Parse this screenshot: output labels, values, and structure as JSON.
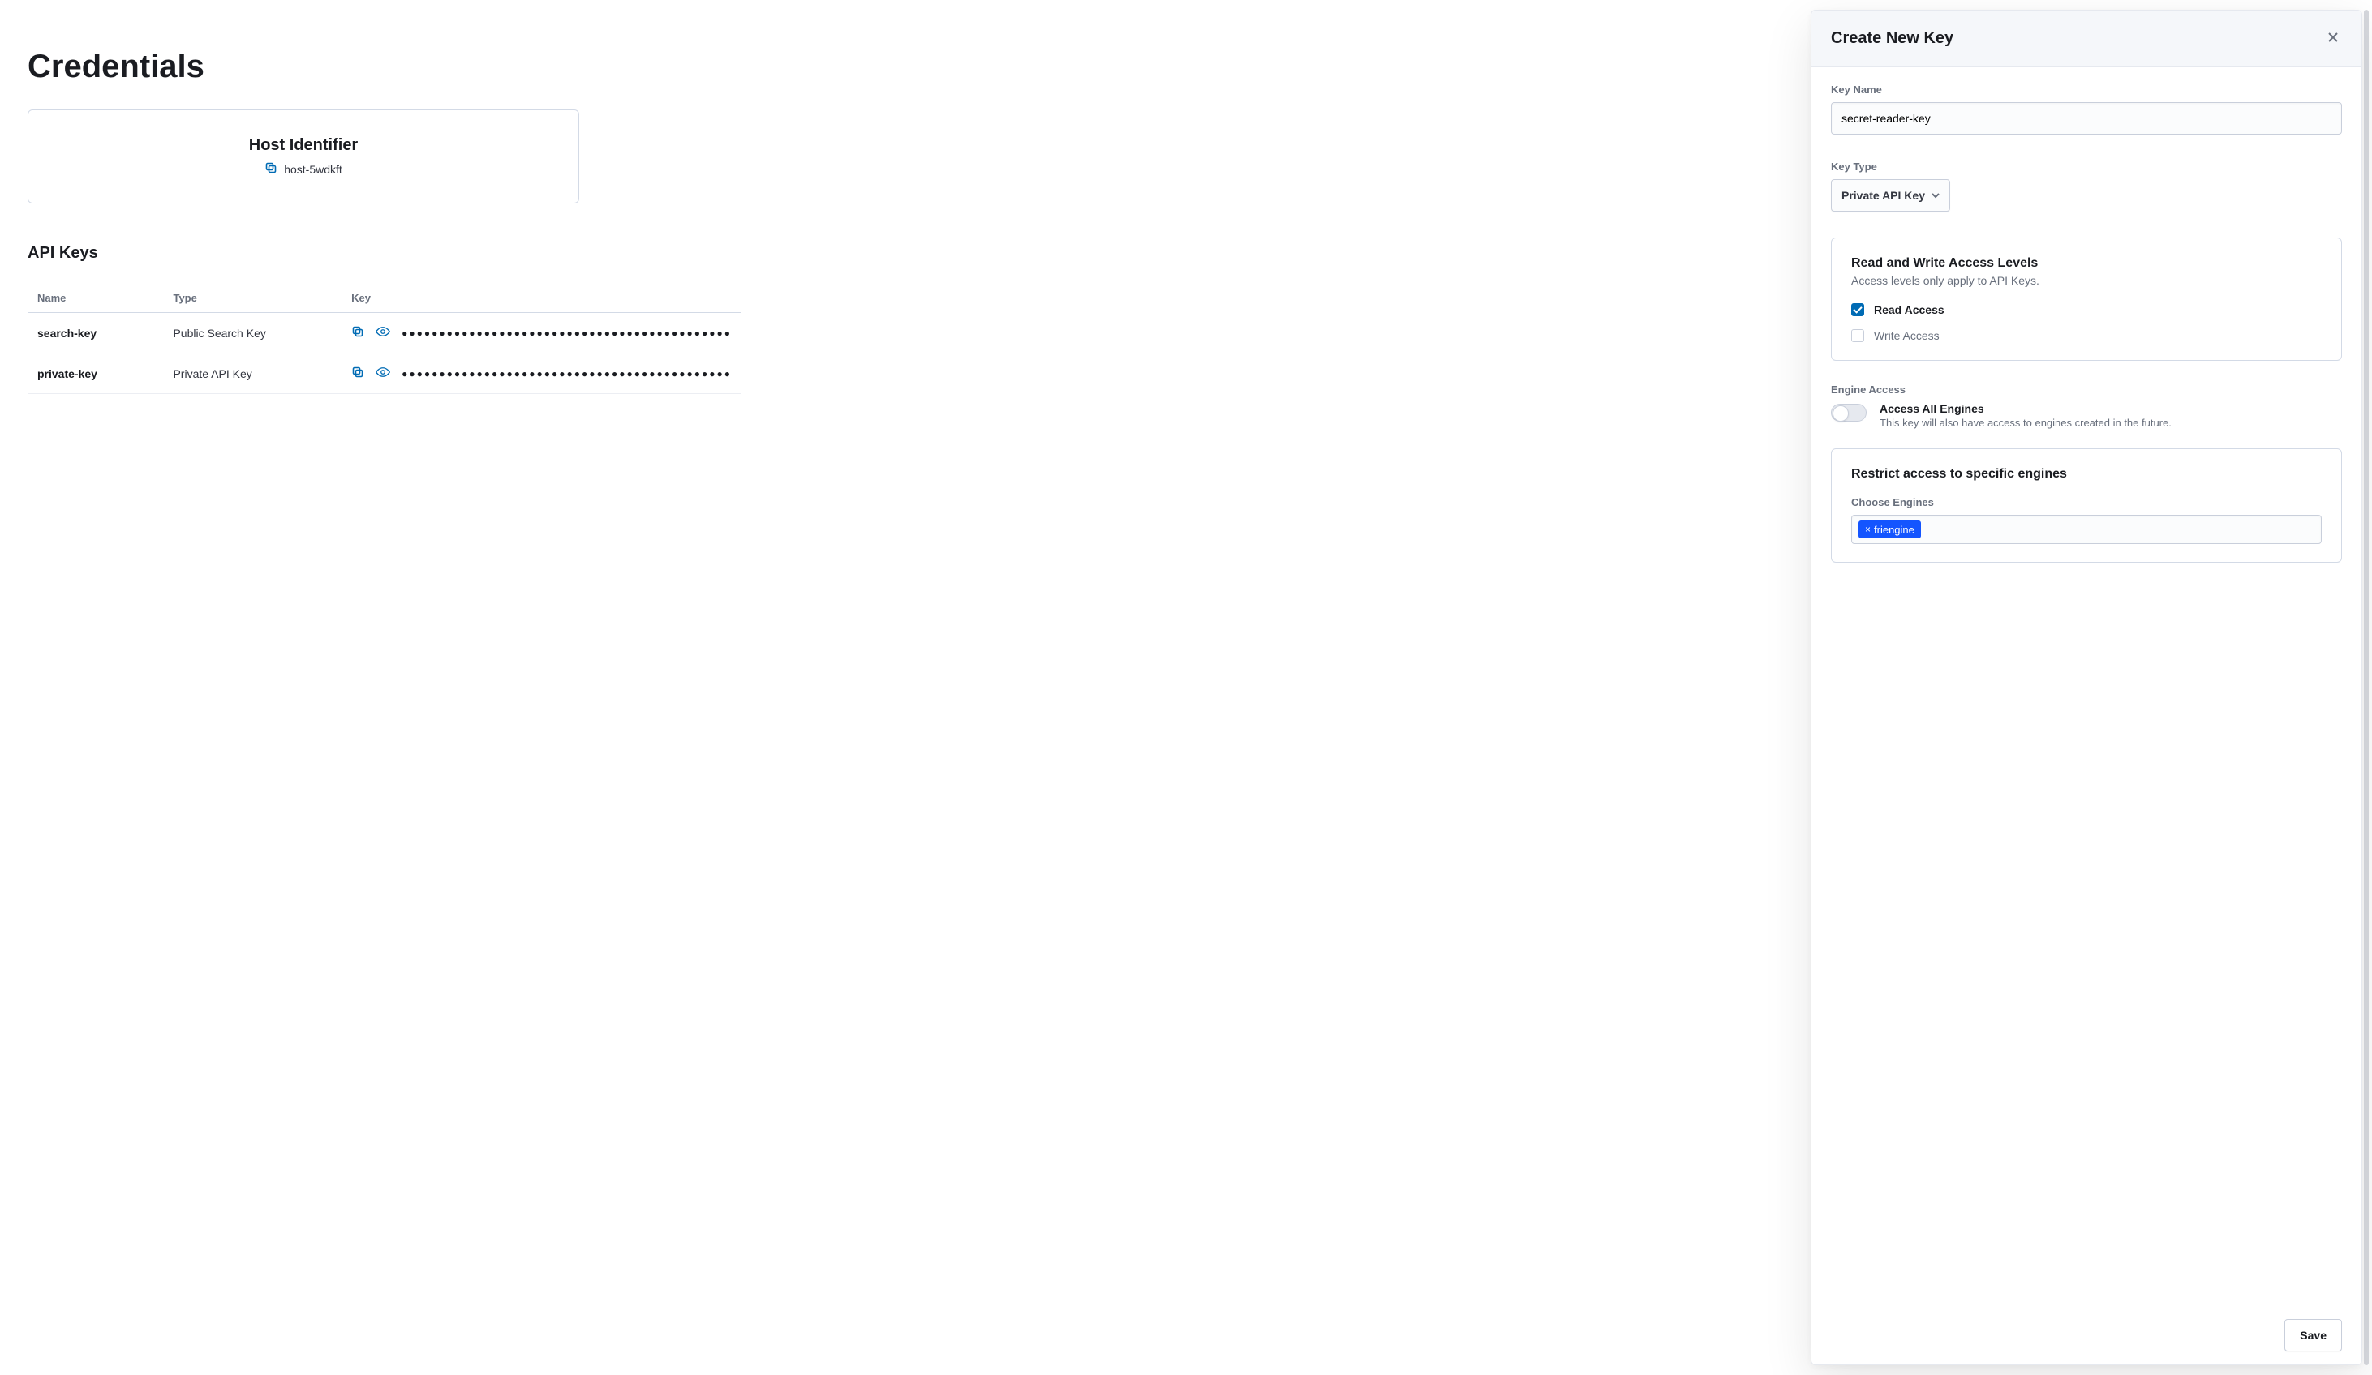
{
  "page": {
    "title": "Credentials",
    "host_identifier_label": "Host Identifier",
    "host_identifier_value": "host-5wdkft",
    "api_keys_label": "API Keys"
  },
  "api_keys_table": {
    "columns": {
      "name": "Name",
      "type": "Type",
      "key": "Key"
    },
    "rows": [
      {
        "name": "search-key",
        "type": "Public Search Key",
        "key_mask": "●●●●●●●●●●●●●●●●●●●●●●●●●●●●●●●●●●●●●●●●●●●●"
      },
      {
        "name": "private-key",
        "type": "Private API Key",
        "key_mask": "●●●●●●●●●●●●●●●●●●●●●●●●●●●●●●●●●●●●●●●●●●●●"
      }
    ]
  },
  "flyout": {
    "title": "Create New Key",
    "key_name_label": "Key Name",
    "key_name_value": "secret-reader-key",
    "key_type_label": "Key Type",
    "key_type_value": "Private API Key",
    "access_levels_title": "Read and Write Access Levels",
    "access_levels_subtitle": "Access levels only apply to API Keys.",
    "read_access_label": "Read Access",
    "read_access_checked": true,
    "write_access_label": "Write Access",
    "write_access_checked": false,
    "engine_access_label": "Engine Access",
    "access_all_title": "Access All Engines",
    "access_all_subtitle": "This key will also have access to engines created in the future.",
    "access_all_on": false,
    "restrict_title": "Restrict access to specific engines",
    "choose_engines_label": "Choose Engines",
    "selected_engines": [
      "friengine"
    ],
    "save_label": "Save"
  }
}
